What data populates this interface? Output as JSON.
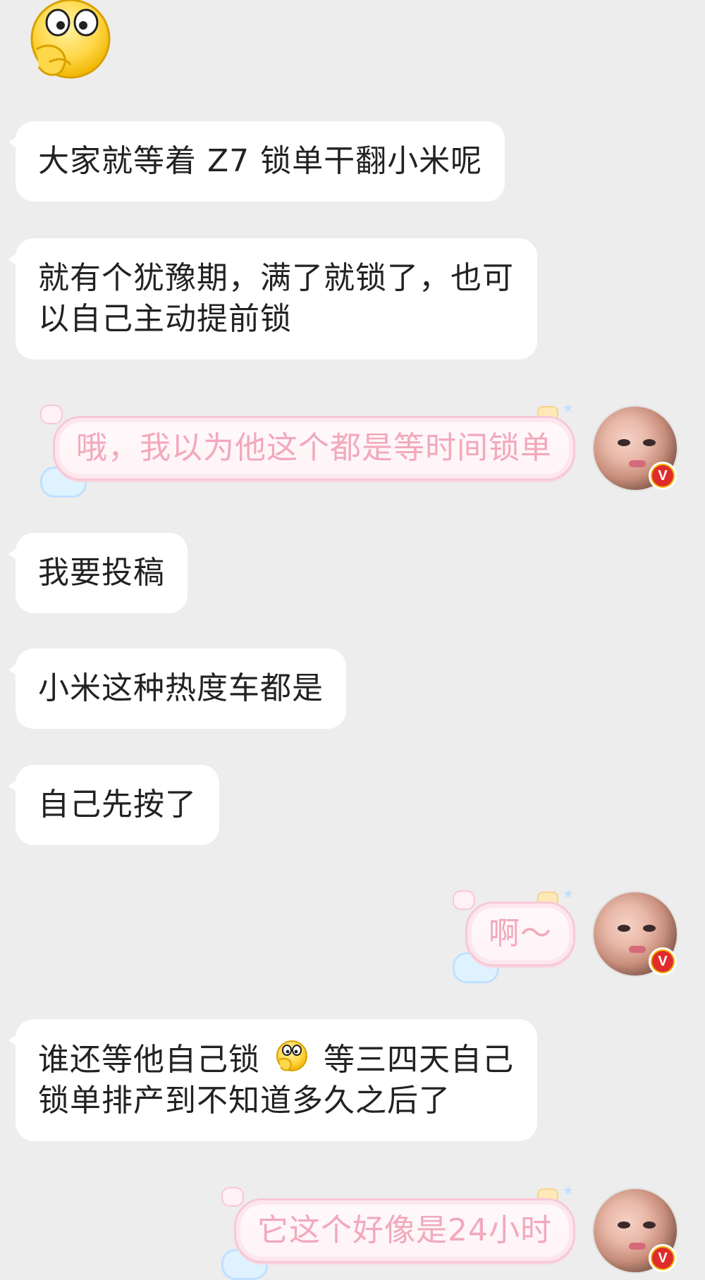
{
  "messages": [
    {
      "side": "left",
      "type": "emoji",
      "emoji": "thinking-face-emoji"
    },
    {
      "side": "left",
      "type": "text",
      "text": "大家就等着 Z7 锁单干翻小米呢"
    },
    {
      "side": "left",
      "type": "text",
      "text": "就有个犹豫期，满了就锁了，也可以自己主动提前锁"
    },
    {
      "side": "right",
      "type": "text",
      "text": "哦，我以为他这个都是等时间锁单",
      "avatar": "avatar-user",
      "badge": "V"
    },
    {
      "side": "left",
      "type": "text",
      "text": "我要投稿"
    },
    {
      "side": "left",
      "type": "text",
      "text": "小米这种热度车都是"
    },
    {
      "side": "left",
      "type": "text",
      "text": "自己先按了"
    },
    {
      "side": "right",
      "type": "text",
      "text": "啊～",
      "avatar": "avatar-user",
      "badge": "V"
    },
    {
      "side": "left",
      "type": "text_with_emoji",
      "text_before": "谁还等他自己锁",
      "emoji": "thinking-face-emoji",
      "text_after": "等三四天自己锁单排产到不知道多久之后了"
    },
    {
      "side": "right",
      "type": "text",
      "text": "它这个好像是24小时",
      "avatar": "avatar-user",
      "badge": "V"
    }
  ],
  "colors": {
    "background": "#ededed",
    "left_bubble": "#ffffff",
    "left_text": "#222222",
    "right_text": "#f2a8bd",
    "right_border": "#f7c8d6",
    "badge_outer": "#f2b300",
    "badge_inner": "#e02b2b"
  }
}
